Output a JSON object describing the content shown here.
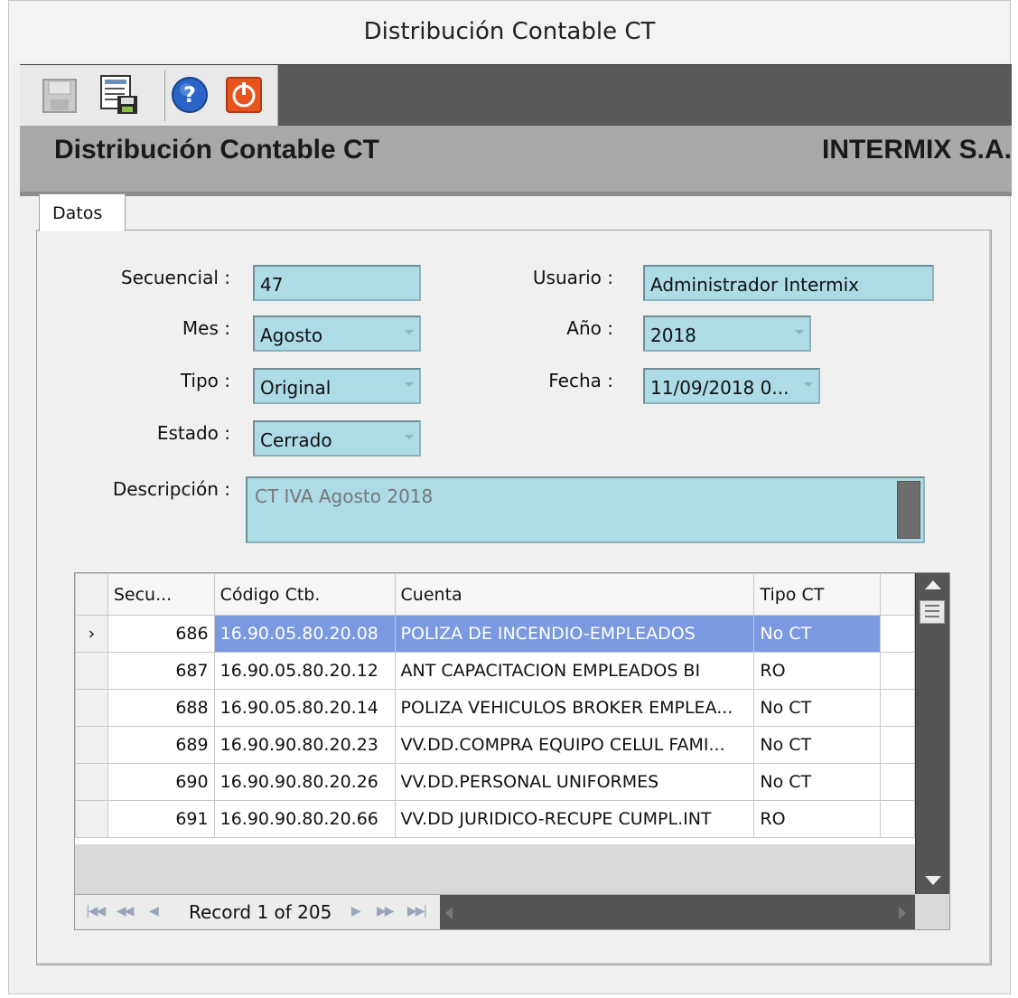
{
  "window": {
    "title": "Distribución Contable CT"
  },
  "banner": {
    "title": "Distribución Contable CT",
    "company": "INTERMIX S.A."
  },
  "tabs": [
    {
      "label": "Datos"
    }
  ],
  "form": {
    "secuencial": {
      "label": "Secuencial :",
      "value": "47"
    },
    "usuario": {
      "label": "Usuario :",
      "value": "Administrador Intermix"
    },
    "mes": {
      "label": "Mes :",
      "value": "Agosto"
    },
    "anio": {
      "label": "Año :",
      "value": "2018"
    },
    "tipo": {
      "label": "Tipo :",
      "value": "Original"
    },
    "fecha": {
      "label": "Fecha :",
      "value": "11/09/2018 0..."
    },
    "estado": {
      "label": "Estado :",
      "value": "Cerrado"
    },
    "descripcion": {
      "label": "Descripción :",
      "value": "CT IVA Agosto 2018"
    }
  },
  "grid": {
    "columns": [
      "Secu...",
      "Código Ctb.",
      "Cuenta",
      "Tipo CT"
    ],
    "rows": [
      {
        "secuencia": "686",
        "codigo": "16.90.05.80.20.08",
        "cuenta": "POLIZA DE INCENDIO-EMPLEADOS",
        "tipo": "No CT"
      },
      {
        "secuencia": "687",
        "codigo": "16.90.05.80.20.12",
        "cuenta": "ANT CAPACITACION EMPLEADOS BI",
        "tipo": "RO"
      },
      {
        "secuencia": "688",
        "codigo": "16.90.05.80.20.14",
        "cuenta": "POLIZA VEHICULOS BROKER EMPLEA...",
        "tipo": "No CT"
      },
      {
        "secuencia": "689",
        "codigo": "16.90.90.80.20.23",
        "cuenta": "VV.DD.COMPRA EQUIPO CELUL FAMI...",
        "tipo": "No CT"
      },
      {
        "secuencia": "690",
        "codigo": "16.90.90.80.20.26",
        "cuenta": "VV.DD.PERSONAL UNIFORMES",
        "tipo": "No CT"
      },
      {
        "secuencia": "691",
        "codigo": "16.90.90.80.20.66",
        "cuenta": "VV.DD JURIDICO-RECUPE CUMPL.INT",
        "tipo": "RO"
      }
    ],
    "selected_marker": "›",
    "navigator": {
      "record_text": "Record 1 of 205"
    }
  },
  "icons": [
    "save-disk-icon",
    "save-form-icon",
    "help-icon",
    "power-exit-icon"
  ],
  "colors": {
    "field_bg": "#addbe6",
    "selected_row": "#7a99e0",
    "toolbar_dark": "#595959",
    "banner_bg": "#a8a8a8"
  }
}
